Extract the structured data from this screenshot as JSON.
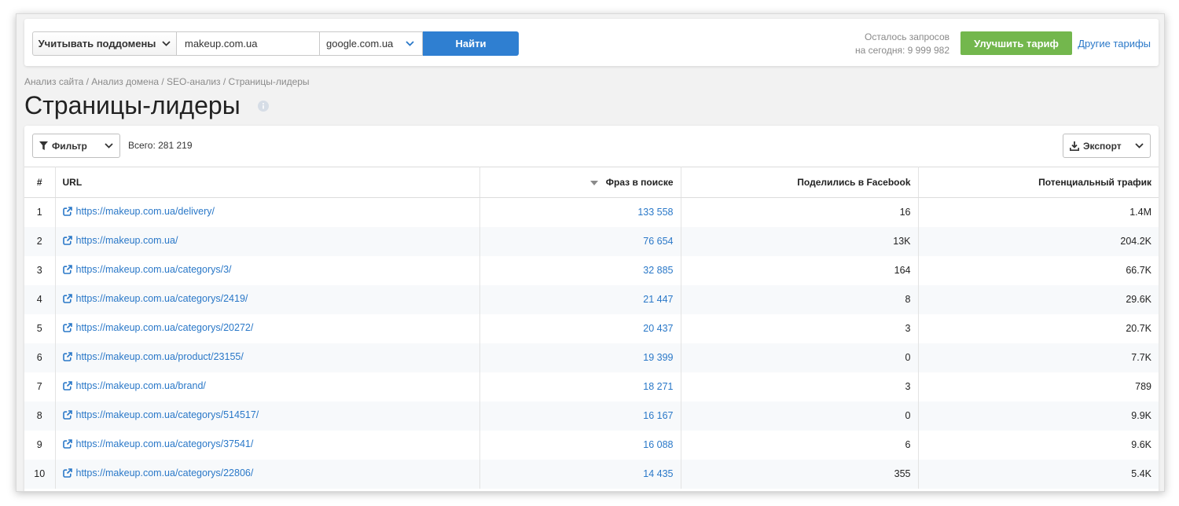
{
  "search": {
    "subdomains_label": "Учитывать поддомены",
    "domain_value": "makeup.com.ua",
    "engine_value": "google.com.ua",
    "search_label": "Найти"
  },
  "account": {
    "quota_line1": "Осталось запросов",
    "quota_line2": "на сегодня: 9 999 982",
    "upgrade_label": "Улучшить тариф",
    "other_plans_label": "Другие тарифы"
  },
  "breadcrumb": "Анализ сайта / Анализ домена / SEO-анализ / Страницы-лидеры",
  "page_title": "Страницы-лидеры",
  "toolbar": {
    "filter_label": "Фильтр",
    "total_label": "Всего: 281 219",
    "export_label": "Экспорт"
  },
  "table": {
    "headers": {
      "num": "#",
      "url": "URL",
      "phrases": "Фраз в поиске",
      "facebook": "Поделились в Facebook",
      "traffic": "Потенциальный трафик"
    },
    "rows": [
      {
        "num": "1",
        "url": "https://makeup.com.ua/delivery/",
        "phrases": "133 558",
        "facebook": "16",
        "traffic": "1.4M"
      },
      {
        "num": "2",
        "url": "https://makeup.com.ua/",
        "phrases": "76 654",
        "facebook": "13K",
        "traffic": "204.2K"
      },
      {
        "num": "3",
        "url": "https://makeup.com.ua/categorys/3/",
        "phrases": "32 885",
        "facebook": "164",
        "traffic": "66.7K"
      },
      {
        "num": "4",
        "url": "https://makeup.com.ua/categorys/2419/",
        "phrases": "21 447",
        "facebook": "8",
        "traffic": "29.6K"
      },
      {
        "num": "5",
        "url": "https://makeup.com.ua/categorys/20272/",
        "phrases": "20 437",
        "facebook": "3",
        "traffic": "20.7K"
      },
      {
        "num": "6",
        "url": "https://makeup.com.ua/product/23155/",
        "phrases": "19 399",
        "facebook": "0",
        "traffic": "7.7K"
      },
      {
        "num": "7",
        "url": "https://makeup.com.ua/brand/",
        "phrases": "18 271",
        "facebook": "3",
        "traffic": "789"
      },
      {
        "num": "8",
        "url": "https://makeup.com.ua/categorys/514517/",
        "phrases": "16 167",
        "facebook": "0",
        "traffic": "9.9K"
      },
      {
        "num": "9",
        "url": "https://makeup.com.ua/categorys/37541/",
        "phrases": "16 088",
        "facebook": "6",
        "traffic": "9.6K"
      },
      {
        "num": "10",
        "url": "https://makeup.com.ua/categorys/22806/",
        "phrases": "14 435",
        "facebook": "355",
        "traffic": "5.4K"
      }
    ]
  },
  "colors": {
    "accent_blue": "#2f7fd1",
    "link_blue": "#2a78c8",
    "upgrade_green": "#73b74d"
  },
  "icons": {
    "subdomains_chevron": "chevron-down-icon",
    "engine_chevron": "chevron-down-icon",
    "info": "info-icon",
    "filter": "filter-icon",
    "export": "download-icon",
    "external_link": "external-link-icon",
    "sort": "sort-desc-icon"
  }
}
